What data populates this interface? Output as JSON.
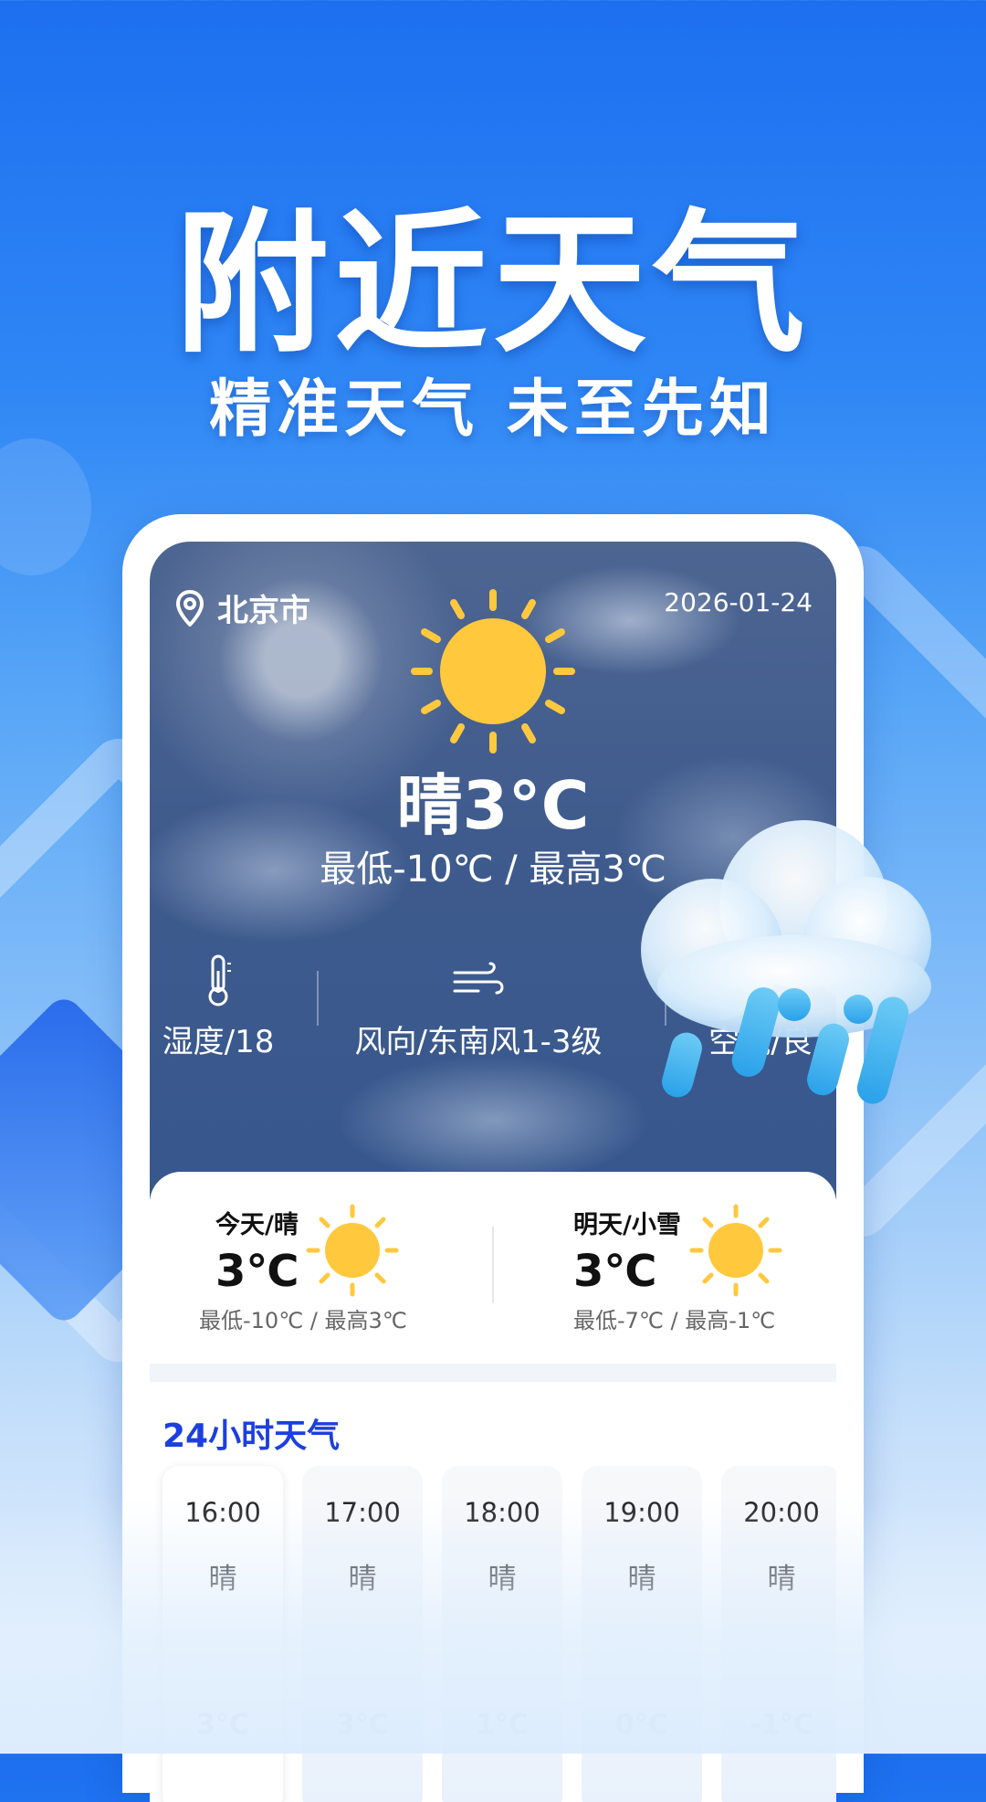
{
  "promo": {
    "headline": "附近天气",
    "subline": "精准天气 未至先知"
  },
  "header": {
    "city": "北京市",
    "date": "2026-01-24",
    "location_icon": "location-pin-icon"
  },
  "current": {
    "condition_temp": "晴3°C",
    "range": "最低-10℃ / 最高3℃",
    "icon": "sun-icon"
  },
  "metrics": [
    {
      "icon": "thermometer-icon",
      "label": "湿度/18"
    },
    {
      "icon": "wind-icon",
      "label": "风向/东南风1-3级"
    },
    {
      "icon": "air-icon",
      "label": "空气/良"
    }
  ],
  "days": [
    {
      "name": "今天/晴",
      "temp": "3℃",
      "minmax": "最低-10℃ / 最高3℃",
      "icon": "sun-icon"
    },
    {
      "name": "明天/小雪",
      "temp": "3℃",
      "minmax": "最低-7℃ / 最高-1℃",
      "icon": "sun-icon"
    }
  ],
  "hourly": {
    "title": "24小时天气",
    "items": [
      {
        "time": "16:00",
        "cond": "晴",
        "temp": "3°C"
      },
      {
        "time": "17:00",
        "cond": "晴",
        "temp": "3°C"
      },
      {
        "time": "18:00",
        "cond": "晴",
        "temp": "1°C"
      },
      {
        "time": "19:00",
        "cond": "晴",
        "temp": "0°C"
      },
      {
        "time": "20:00",
        "cond": "晴",
        "temp": "-1°C"
      }
    ]
  },
  "colors": {
    "sun": "#ffc83d",
    "section_title": "#1c3fe0",
    "background_top": "#1d6ff0"
  }
}
